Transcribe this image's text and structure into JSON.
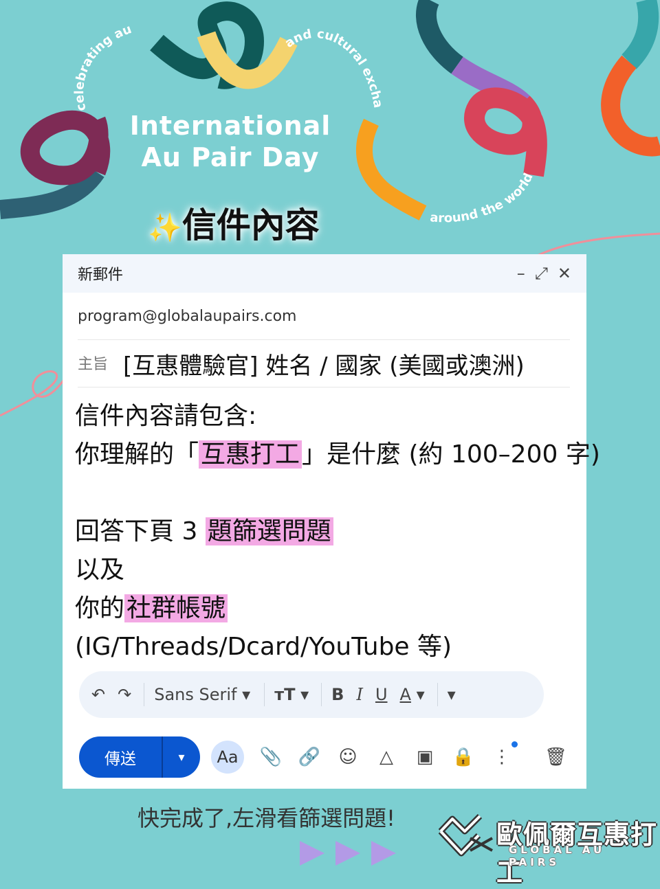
{
  "hero": {
    "title_line1": "International",
    "title_line2": "Au Pair Day",
    "arc_left": "celebrating au pairs",
    "arc_top_right": "and cultural exchange",
    "arc_bottom": "around the world"
  },
  "section_heading": {
    "sparkle": "✨",
    "text": "信件內容"
  },
  "compose": {
    "title": "新郵件",
    "controls": {
      "minimize": "–",
      "expand": "⤢",
      "close": "✕"
    },
    "to": "program@globalaupairs.com",
    "subject_label": "主旨",
    "subject": "[互惠體驗官] 姓名 / 國家 (美國或澳洲)",
    "body": {
      "line1": "信件內容請包含:",
      "line2_pre": "你理解的「",
      "line2_hl": "互惠打工",
      "line2_post": "」是什麼 (約 100–200 字)",
      "line4_pre": "回答下頁 3 ",
      "line4_hl": "題篩選問題",
      "line5": "以及",
      "line6_pre": "你的",
      "line6_hl": "社群帳號",
      "line7": " (IG/Threads/Dcard/YouTube 等)"
    },
    "toolbar": {
      "undo": "↶",
      "redo": "↷",
      "font": "Sans Serif",
      "font_caret": "▾",
      "size": "тT",
      "size_caret": "▾",
      "bold": "B",
      "italic": "I",
      "underline": "U",
      "color": "A",
      "color_caret": "▾",
      "more_caret": "▾"
    },
    "actions": {
      "send": "傳送",
      "send_caret": "▾",
      "format": "Aa",
      "attach": "📎",
      "link": "🔗",
      "emoji": "☺",
      "drive": "△",
      "photo": "▣",
      "confidential": "🔒",
      "more": "⋮",
      "trash": "🗑"
    }
  },
  "footer": {
    "hint": "快完成了,左滑看篩選問題!"
  },
  "brand": {
    "name_cn": "歐佩爾互惠打工",
    "name_en": "GLOBAL AU PAIRS"
  },
  "colors": {
    "background": "#7ccfd1",
    "highlight": "#f3a9e4",
    "send": "#0b57d0"
  }
}
